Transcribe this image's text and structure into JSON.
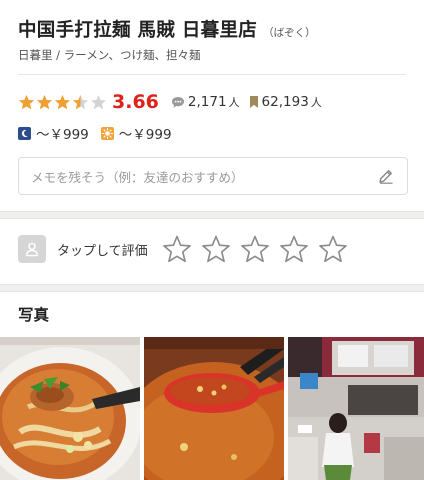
{
  "restaurant": {
    "name": "中国手打拉麺 馬賊 日暮里店",
    "reading": "（ばぞく）",
    "genre": "日暮里 / ラーメン、つけ麺、担々麺"
  },
  "rating": {
    "score": "3.66",
    "stars_value": 3.66,
    "reviews_count": "2,171",
    "reviews_unit": "人",
    "bookmarks_count": "62,193",
    "bookmarks_unit": "人"
  },
  "budget": {
    "dinner": "～￥999",
    "lunch": "～￥999",
    "dinner_icon": "moon-icon",
    "lunch_icon": "sun-icon"
  },
  "memo": {
    "placeholder": "メモを残そう（例：友達のおすすめ）"
  },
  "evaluation": {
    "label": "タップして評価",
    "star_count": 5
  },
  "photos": {
    "title": "写真",
    "items": [
      "ramen-photo",
      "soup-spoon-photo",
      "interior-photo"
    ]
  },
  "colors": {
    "star_filled": "#f0a030",
    "star_empty": "#d4d4d4",
    "score": "#e0201b",
    "night_badge": "#2c4c8c",
    "day_badge": "#f3a43a"
  }
}
